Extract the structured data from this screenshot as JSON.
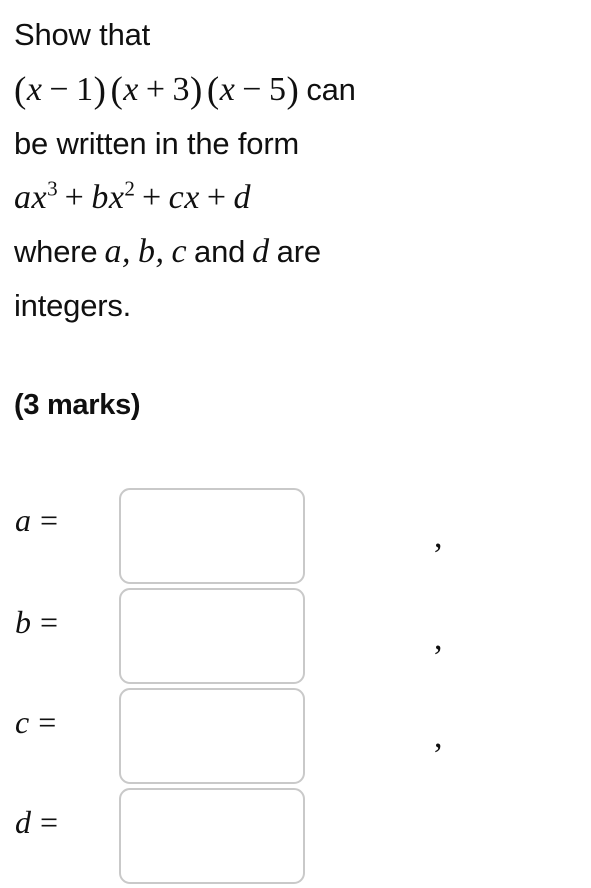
{
  "question": {
    "line1": "Show that",
    "line2_math": {
      "factor1": {
        "open": "(",
        "var": "x",
        "op": "−",
        "num": "1",
        "close": ")"
      },
      "factor2": {
        "open": "(",
        "var": "x",
        "op": "+",
        "num": "3",
        "close": ")"
      },
      "factor3": {
        "open": "(",
        "var": "x",
        "op": "−",
        "num": "5",
        "close": ")"
      },
      "trailing_text": "can"
    },
    "line3": "be written in the form",
    "line4_math": {
      "term1_coef": "a",
      "term1_var": "x",
      "term1_exp": "3",
      "op1": "+",
      "term2_coef": "b",
      "term2_var": "x",
      "term2_exp": "2",
      "op2": "+",
      "term3_coef": "c",
      "term3_var": "x",
      "op3": "+",
      "term4": "d"
    },
    "line5": {
      "prefix": "where",
      "var_a": "a",
      "comma1": ",",
      "var_b": "b",
      "comma2": ",",
      "var_c": "c",
      "middle": "and",
      "var_d": "d",
      "suffix": "are"
    },
    "line6": "integers.",
    "marks": "(3 marks)"
  },
  "answers": {
    "rows": [
      {
        "label": "a",
        "equals": "=",
        "value": "",
        "placeholder": "",
        "separator": ","
      },
      {
        "label": "b",
        "equals": "=",
        "value": "",
        "placeholder": "",
        "separator": ","
      },
      {
        "label": "c",
        "equals": "=",
        "value": "",
        "placeholder": "",
        "separator": ","
      },
      {
        "label": "d",
        "equals": "=",
        "value": "",
        "placeholder": "",
        "separator": ""
      }
    ]
  },
  "colors": {
    "background": "#ffffff",
    "text": "#101010",
    "input_border": "#c9c9c9"
  }
}
